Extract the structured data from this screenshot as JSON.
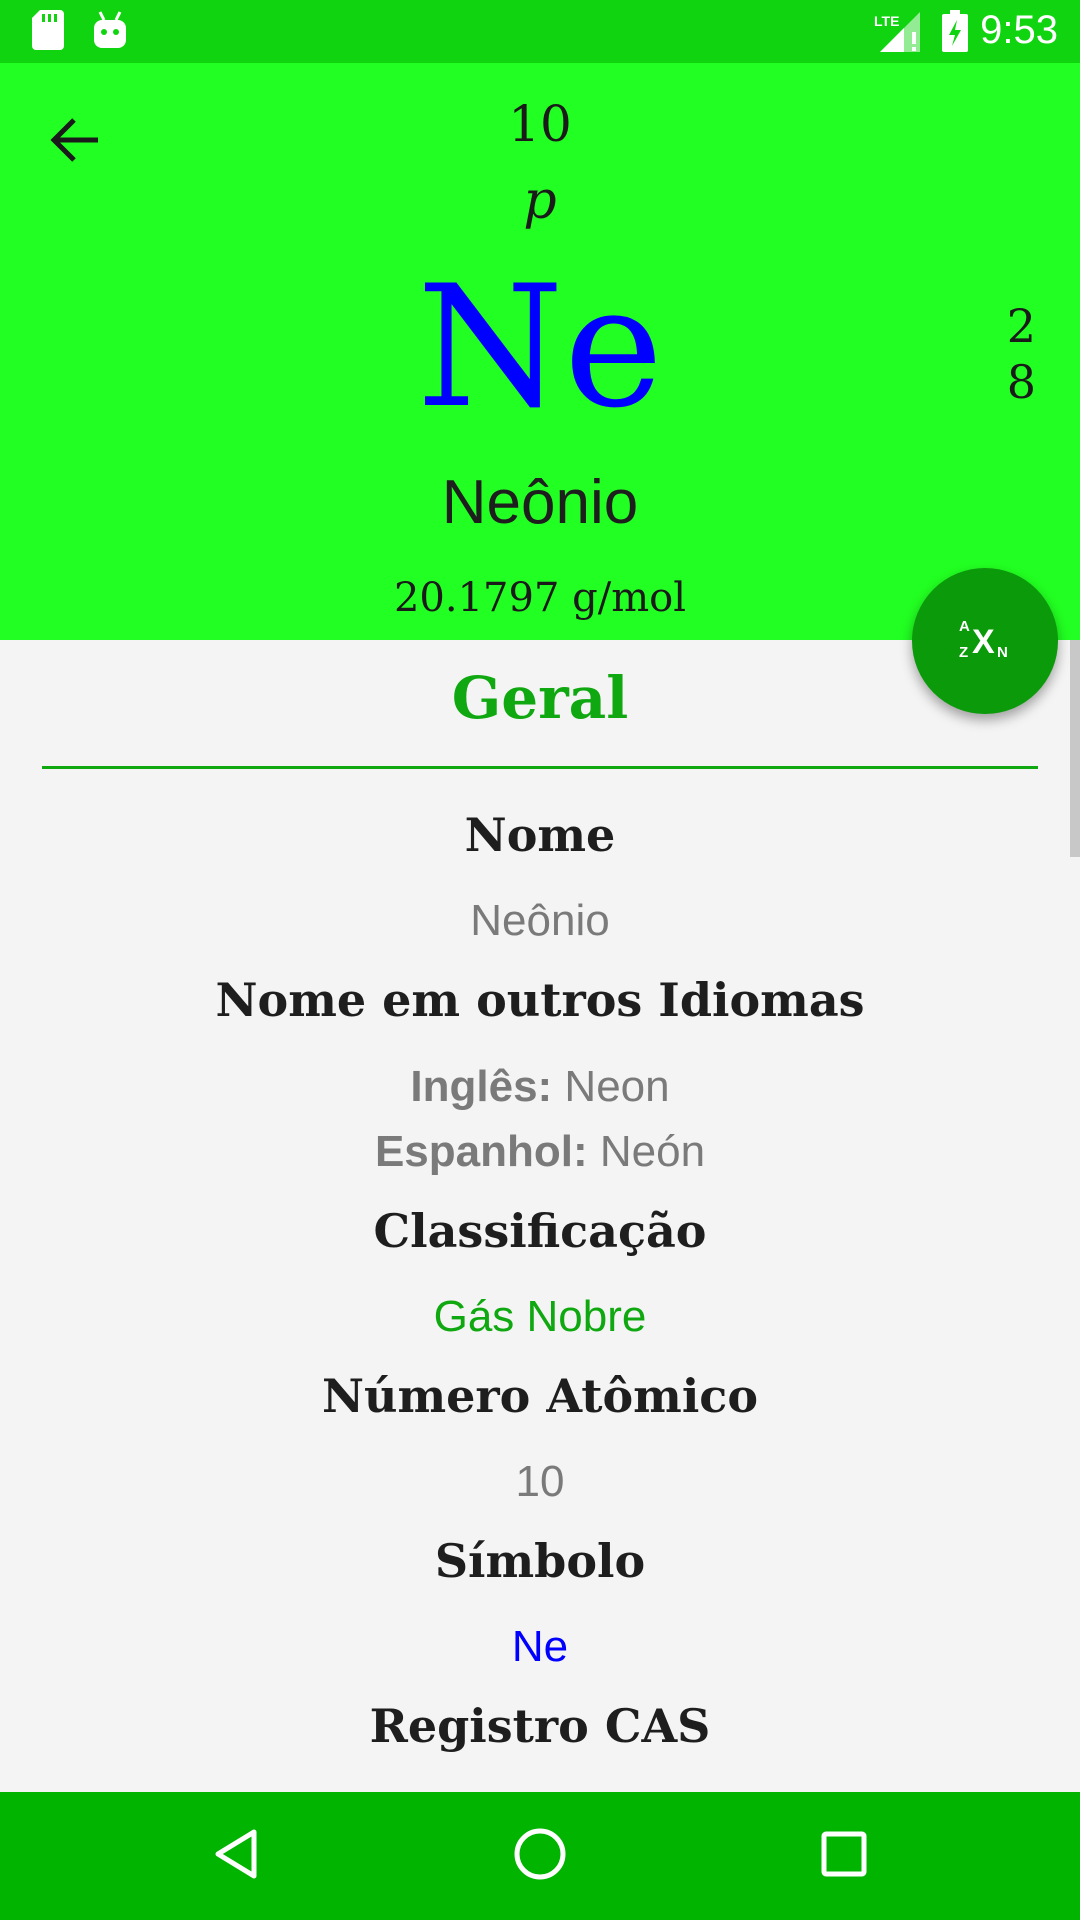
{
  "status_bar": {
    "time": "9:53",
    "icons": [
      "sd-card-icon",
      "android-icon",
      "lte-signal-icon",
      "battery-charging-icon"
    ],
    "color": "#10d410"
  },
  "header": {
    "back_icon": "arrow-back-icon",
    "atomic_number": "10",
    "block": "p",
    "symbol": "Ne",
    "shells": [
      "2",
      "8"
    ],
    "name": "Neônio",
    "molar_mass": "20.1797 g/mol",
    "fab_icon": "isotope-notation-icon",
    "background": "#22ff22",
    "symbol_color": "#0000ff"
  },
  "content": {
    "section_title": "Geral",
    "fields": {
      "name_label": "Nome",
      "name_value": "Neônio",
      "other_lang_label": "Nome em outros Idiomas",
      "english_label": "Inglês:",
      "english_value": "Neon",
      "spanish_label": "Espanhol:",
      "spanish_value": "Neón",
      "classification_label": "Classificação",
      "classification_value": "Gás Nobre",
      "atomic_number_label": "Número Atômico",
      "atomic_number_value": "10",
      "symbol_label": "Símbolo",
      "symbol_value": "Ne",
      "cas_label": "Registro CAS"
    },
    "accent": "#10a810"
  },
  "nav_bar": {
    "icons": [
      "back-triangle-icon",
      "home-circle-icon",
      "recents-square-icon"
    ],
    "color": "#00b400"
  }
}
